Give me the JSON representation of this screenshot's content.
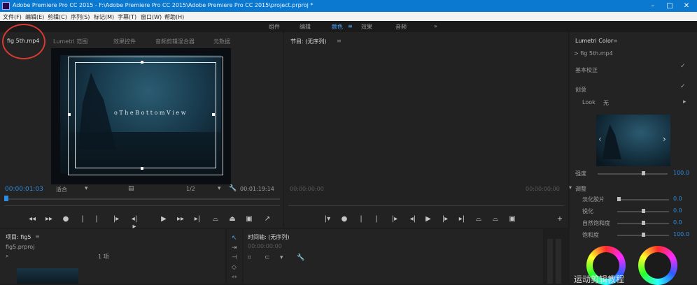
{
  "titlebar": {
    "title": "Adobe Premiere Pro CC 2015 - F:\\Adobe Premiere Pro CC 2015\\Adobe Premiere Pro CC 2015\\project.prproj *",
    "minimize": "–",
    "maximize": "□",
    "close": "✕"
  },
  "menu": [
    "文件(F)",
    "编辑(E)",
    "剪辑(C)",
    "序列(S)",
    "标记(M)",
    "字幕(T)",
    "窗口(W)",
    "帮助(H)"
  ],
  "workspaces": [
    "组件",
    "编辑",
    "颜色",
    "效果",
    "音频"
  ],
  "source": {
    "tabs": [
      "fig 5th.mp4",
      "Lumetri 范围",
      "效果控件",
      "音频剪辑混合器",
      "元数据"
    ],
    "overlay_text": "o  T h e  B o t t o m  V i e w",
    "timecode": "00:00:01:03",
    "fit": "适合",
    "resolution": "1/2",
    "duration": "00:01:19:14"
  },
  "program": {
    "title": "节目: (无序列)",
    "timecode_left": "00:00:00:00",
    "timecode_right": "00:00:00:00"
  },
  "lumetri": {
    "tab": "Lumetri Color",
    "clip": "> fig 5th.mp4",
    "sections": {
      "basic": "基本校正",
      "creative": "创意",
      "adjust": "调整"
    },
    "look_label": "Look",
    "look_value": "无",
    "intensity_label": "强度",
    "intensity_value": "100.0",
    "sliders": [
      {
        "label": "淡化胶片",
        "value": "0.0",
        "level": 0.0
      },
      {
        "label": "锐化",
        "value": "0.0",
        "level": 0.5
      },
      {
        "label": "自然饱和度",
        "value": "0.0",
        "level": 0.5
      },
      {
        "label": "饱和度",
        "value": "100.0",
        "level": 0.5
      }
    ]
  },
  "project": {
    "tab": "项目: fig5",
    "bin": "fig5.prproj",
    "count": "1 项"
  },
  "timeline": {
    "title": "时间轴: (无序列)",
    "timecode": "00:00:00:00"
  },
  "watermark": "运动剪辑教程"
}
